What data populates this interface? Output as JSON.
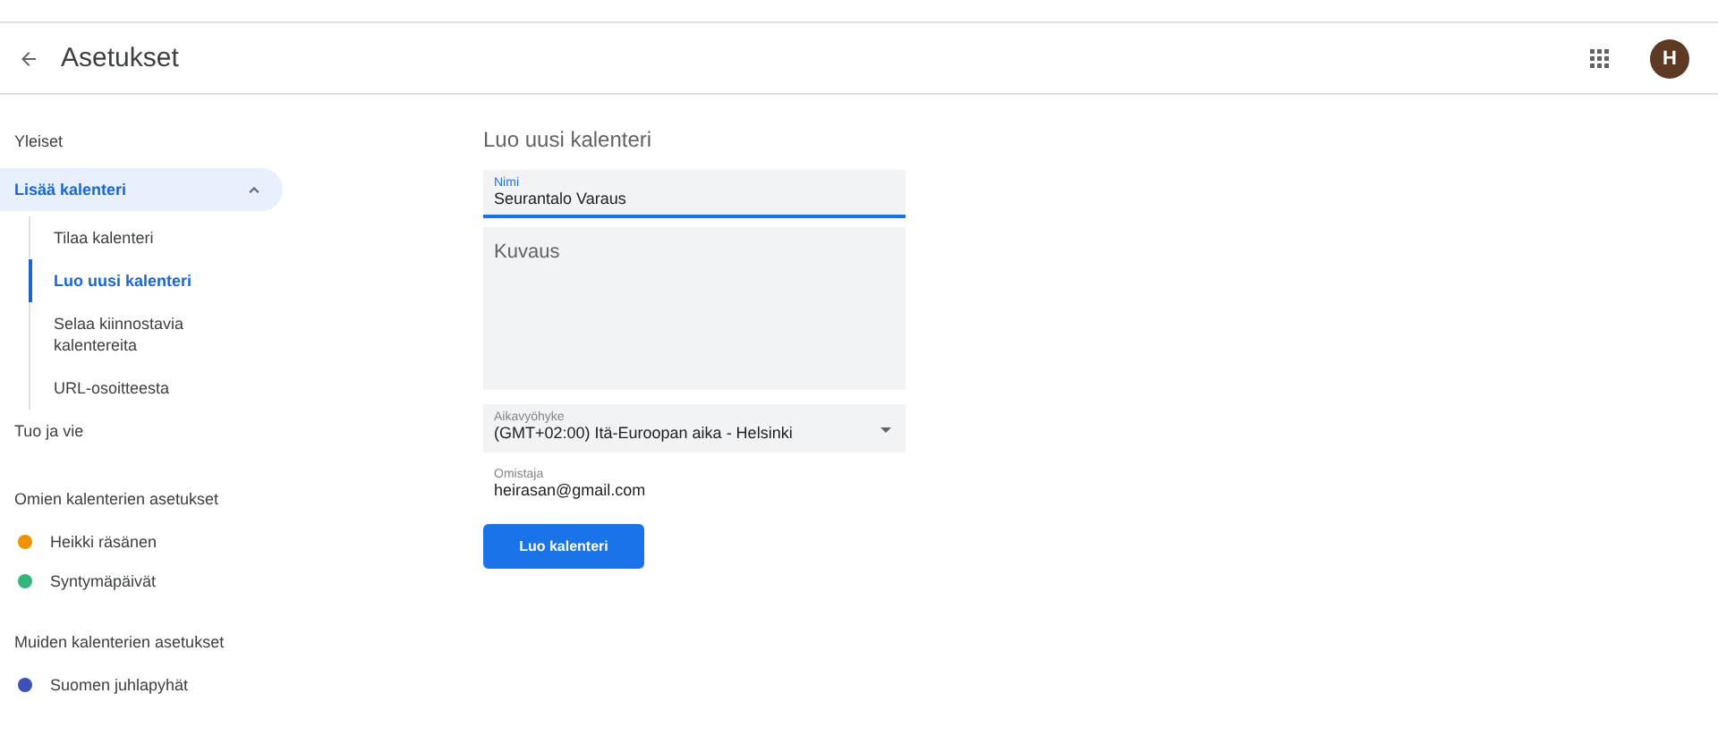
{
  "header": {
    "title": "Asetukset",
    "avatar": "H"
  },
  "sidebar": {
    "items": [
      {
        "label": "Yleiset",
        "expanded": false
      },
      {
        "label": "Lisää kalenteri",
        "expanded": true,
        "children": [
          {
            "label": "Tilaa kalenteri",
            "selected": false
          },
          {
            "label": "Luo uusi kalenteri",
            "selected": true
          },
          {
            "label": "Selaa kiinnostavia kalentereita",
            "selected": false
          },
          {
            "label": "URL-osoitteesta",
            "selected": false
          }
        ]
      },
      {
        "label": "Tuo ja vie",
        "expanded": false
      }
    ],
    "sections": [
      {
        "title": "Omien kalenterien asetukset",
        "calendars": [
          {
            "name": "Heikki räsänen",
            "color": "#f09300"
          },
          {
            "name": "Syntymäpäivät",
            "color": "#33b679"
          }
        ]
      },
      {
        "title": "Muiden kalenterien asetukset",
        "calendars": [
          {
            "name": "Suomen juhlapyhät",
            "color": "#3f51b5"
          }
        ]
      }
    ]
  },
  "form": {
    "title": "Luo uusi kalenteri",
    "name": {
      "label": "Nimi",
      "value": "Seurantalo Varaus"
    },
    "description": {
      "placeholder": "Kuvaus"
    },
    "timezone": {
      "label": "Aikavyöhyke",
      "value": "(GMT+02:00) Itä-Euroopan aika - Helsinki"
    },
    "owner": {
      "label": "Omistaja",
      "value": "heirasan@gmail.com"
    },
    "submit": "Luo kalenteri"
  }
}
